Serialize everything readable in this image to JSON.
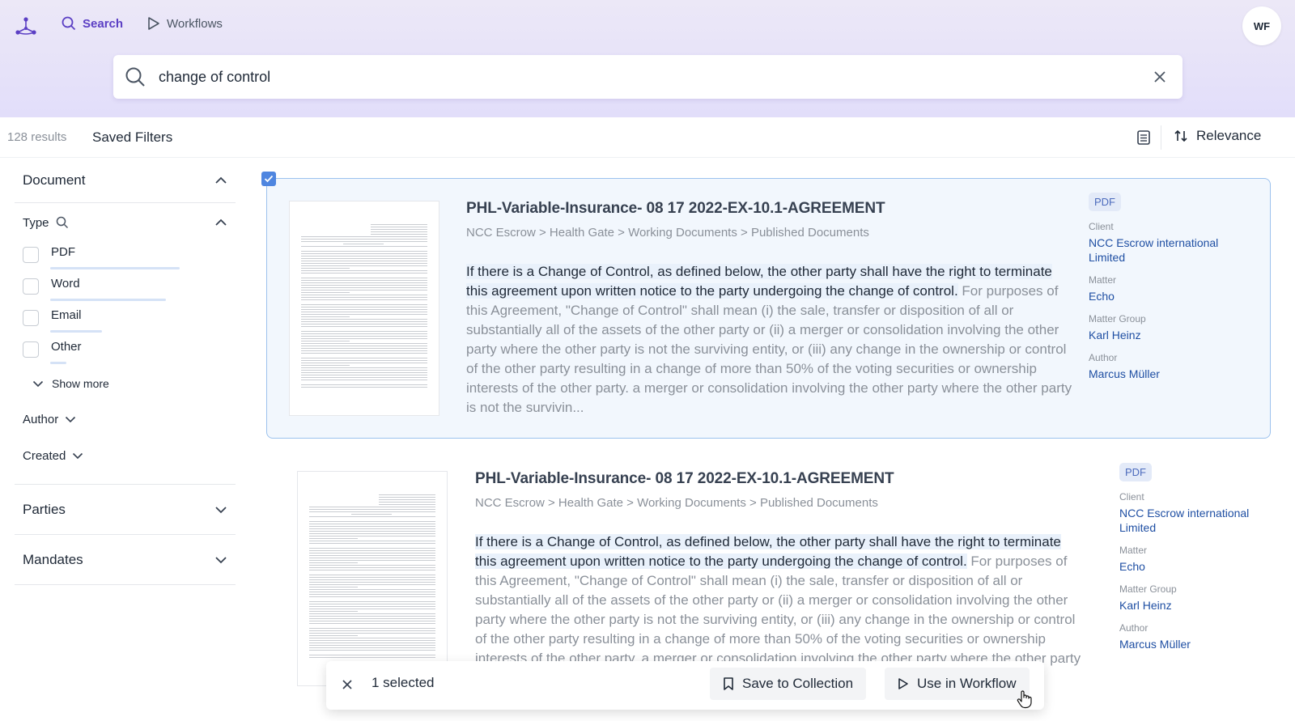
{
  "nav": {
    "search": "Search",
    "workflows": "Workflows",
    "avatar": "WF"
  },
  "search": {
    "query": "change of control"
  },
  "toolbar": {
    "count": "128 results",
    "saved_filters": "Saved Filters",
    "sort": "Relevance"
  },
  "sidebar": {
    "document": "Document",
    "type": "Type",
    "options": [
      {
        "label": "PDF",
        "fraction": 0.95
      },
      {
        "label": "Word",
        "fraction": 0.85
      },
      {
        "label": "Email",
        "fraction": 0.38
      },
      {
        "label": "Other",
        "fraction": 0.12
      }
    ],
    "show_more": "Show more",
    "author": "Author",
    "created": "Created",
    "parties": "Parties",
    "mandates": "Mandates"
  },
  "results": [
    {
      "title": "PHL-Variable-Insurance- 08 17 2022-EX-10.1-AGREEMENT",
      "path": "NCC Escrow > Health Gate > Working Documents > Published Documents",
      "highlight": "If there is a Change of Control, as defined below, the other party shall have the right to terminate this agreement upon written notice to the party undergoing the change of control.",
      "rest": " For purposes of this Agreement, \"Change of Control\" shall mean (i) the sale, transfer or disposition of all or substantially all of the assets of the other party or (ii) a merger or consolidation involving the other party where the other party is not the surviving entity, or (iii) any change in the ownership or control of the other party resulting in a change of more than 50% of the voting securities or ownership interests of the other party. a merger or consolidation involving the other party where the other party is not the survivin...",
      "type": "PDF",
      "client_label": "Client",
      "client": "NCC Escrow international Limited",
      "matter_label": "Matter",
      "matter": "Echo",
      "group_label": "Matter Group",
      "group": "Karl Heinz",
      "author_label": "Author",
      "author": "Marcus Müller"
    },
    {
      "title": "PHL-Variable-Insurance- 08 17 2022-EX-10.1-AGREEMENT",
      "path": "NCC Escrow > Health Gate > Working Documents > Published Documents",
      "highlight": "If there is a Change of Control, as defined below, the other party shall have the right to terminate this agreement upon written notice to the party undergoing the change of control.",
      "rest": " For purposes of this Agreement, \"Change of Control\" shall mean (i) the sale, transfer or disposition of all or substantially all of the assets of the other party or (ii) a merger or consolidation involving the other party where the other party is not the surviving entity, or (iii) any change in the ownership or control of the other party resulting in a change of more than 50% of the voting securities or ownership interests of the other party. a merger or consolidation involving the other party where the other party is not the survivin...",
      "type": "PDF",
      "client_label": "Client",
      "client": "NCC Escrow international Limited",
      "matter_label": "Matter",
      "matter": "Echo",
      "group_label": "Matter Group",
      "group": "Karl Heinz",
      "author_label": "Author",
      "author": "Marcus Müller"
    }
  ],
  "actionbar": {
    "selected": "1 selected",
    "save": "Save to Collection",
    "use": "Use in Workflow"
  },
  "colors": {
    "accent": "#5b3fc4",
    "link": "#1f4fa3",
    "selected_border": "#9cc2ee",
    "checkbox": "#4f86e0"
  }
}
